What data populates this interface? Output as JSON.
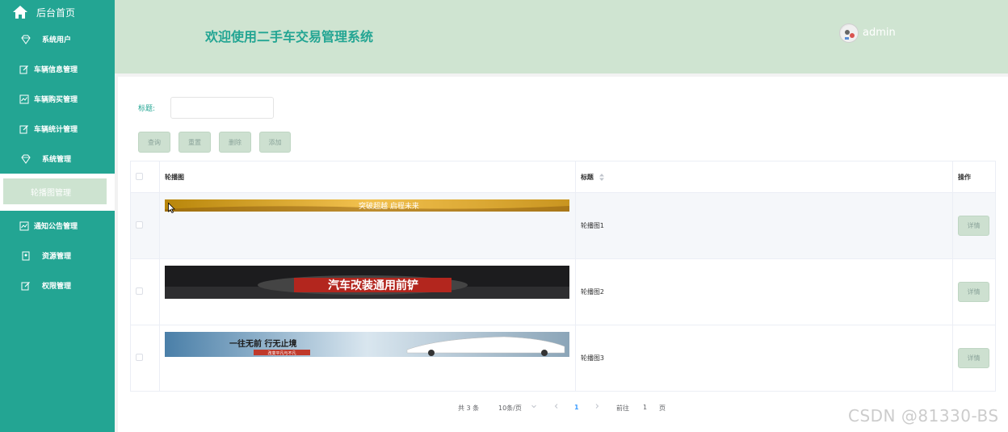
{
  "sidebar": {
    "home_label": "后台首页",
    "items": [
      {
        "label": "系统用户",
        "icon": "diamond-icon"
      },
      {
        "label": "车辆信息管理",
        "icon": "edit-icon"
      },
      {
        "label": "车辆购买管理",
        "icon": "chart-icon"
      },
      {
        "label": "车辆统计管理",
        "icon": "edit-icon"
      },
      {
        "label": "系统管理",
        "icon": "diamond-icon"
      },
      {
        "label": "轮播图管理",
        "active": true
      },
      {
        "label": "通知公告管理",
        "icon": "chart-icon"
      },
      {
        "label": "资源管理",
        "icon": "doc-icon"
      },
      {
        "label": "权限管理",
        "icon": "edit-icon"
      }
    ]
  },
  "header": {
    "title": "欢迎使用二手车交易管理系统",
    "username": "admin"
  },
  "search": {
    "label": "标题:",
    "value": "",
    "placeholder": ""
  },
  "toolbar": {
    "query_label": "查询",
    "reset_label": "重置",
    "delete_label": "删除",
    "add_label": "添加"
  },
  "table": {
    "headers": [
      "轮播图",
      "标题",
      "操作"
    ],
    "rows": [
      {
        "title": "轮播图1",
        "banner_text": "突破超越 启程未来",
        "action": "详情"
      },
      {
        "title": "轮播图2",
        "banner_text": "汽车改装通用前铲",
        "action": "详情"
      },
      {
        "title": "轮播图3",
        "banner_text": "一往无前 行无止境",
        "banner_sub": "改变平凡与不凡",
        "action": "详情"
      }
    ]
  },
  "pagination": {
    "total": "共 3 条",
    "page_size": "10条/页",
    "current": "1",
    "goto_prefix": "前往",
    "goto_value": "1",
    "goto_suffix": "页"
  },
  "watermark": "CSDN @81330-BS",
  "colors": {
    "sidebar": "#23a593",
    "header": "#cfe4d1",
    "accent": "#23a593",
    "button": "#cde0d0"
  }
}
